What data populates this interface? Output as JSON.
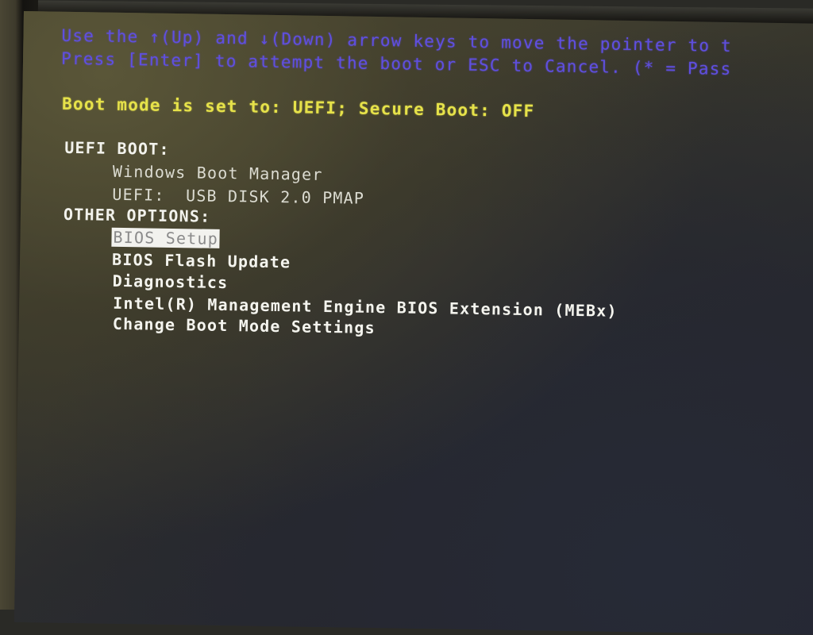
{
  "help": {
    "line1": "Use the ↑(Up) and ↓(Down) arrow keys to move the pointer to t",
    "line2": "Press [Enter] to attempt the boot or ESC to Cancel. (* = Pass"
  },
  "boot_status": {
    "text": "Boot mode is set to: UEFI; Secure Boot: OFF",
    "color": "#e6e24a"
  },
  "uefi_boot": {
    "heading": "UEFI BOOT:",
    "items": [
      {
        "label": "Windows Boot Manager"
      },
      {
        "label": "UEFI:  USB DISK 2.0 PMAP"
      }
    ]
  },
  "other_options": {
    "heading": "OTHER OPTIONS:",
    "items": [
      {
        "label": "BIOS Setup",
        "selected": true
      },
      {
        "label": "BIOS Flash Update"
      },
      {
        "label": "Diagnostics"
      },
      {
        "label": "Intel(R) Management Engine BIOS Extension (MEBx)"
      },
      {
        "label": "Change Boot Mode Settings"
      }
    ]
  },
  "colors": {
    "help_text": "#5f4fe0",
    "status_text": "#e6e24a",
    "menu_text": "#f2f2ec",
    "selection_bg": "#f2f2ee"
  }
}
